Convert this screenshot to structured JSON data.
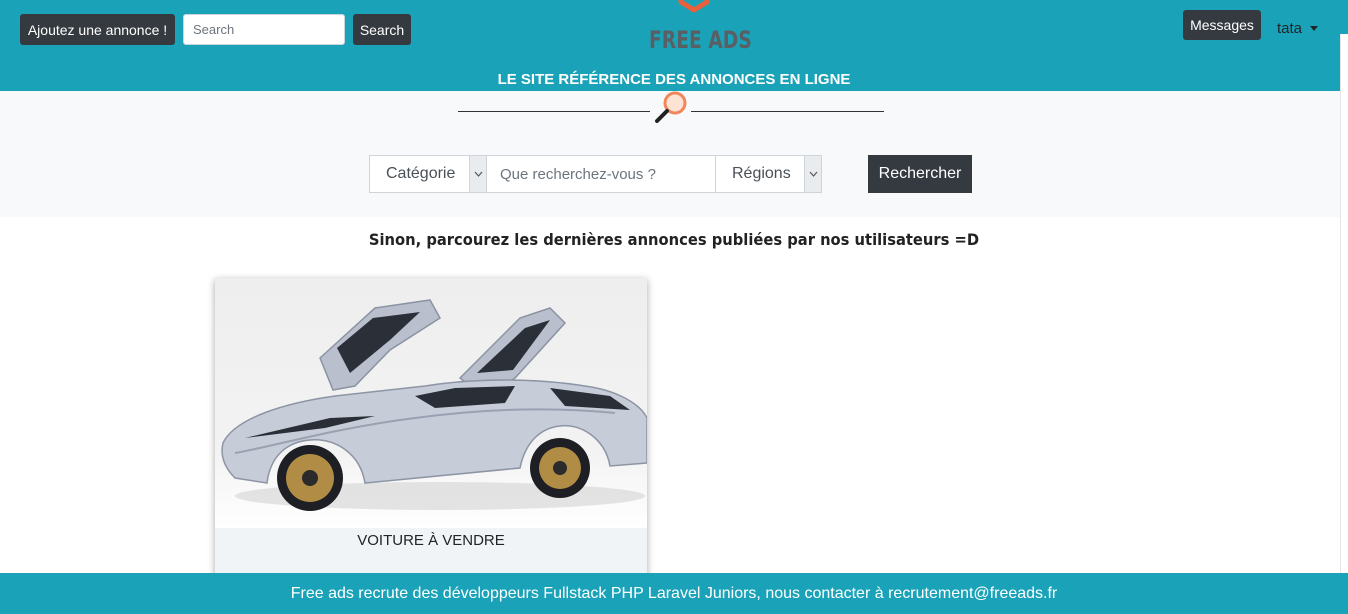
{
  "header": {
    "add_listing_label": "Ajoutez une annonce !",
    "search_placeholder": "Search",
    "search_button_label": "Search",
    "logo_text": "FREE ADS",
    "tagline": "LE SITE RÉFÉRENCE DES ANNONCES EN LIGNE",
    "messages_label": "Messages",
    "username": "tata"
  },
  "search_band": {
    "category_select": "Catégorie",
    "query_placeholder": "Que recherchez-vous ?",
    "region_select": "Régions",
    "submit_label": "Rechercher",
    "icon": "magnifier-icon"
  },
  "main": {
    "intro_text": "Sinon, parcourez les dernières annonces publiées par nos utilisateurs =D",
    "listings": [
      {
        "title": "VOITURE À VENDRE",
        "image": "silver-sports-car"
      }
    ]
  },
  "footer": {
    "text": "Free ads recrute des développeurs Fullstack PHP Laravel Juniors, nous contacter à recrutement@freeads.fr"
  },
  "colors": {
    "header_bg": "#1aa3b8",
    "dark_button": "#343a40",
    "band_bg": "#f8f9fa",
    "logo_orange": "#e8613c"
  }
}
